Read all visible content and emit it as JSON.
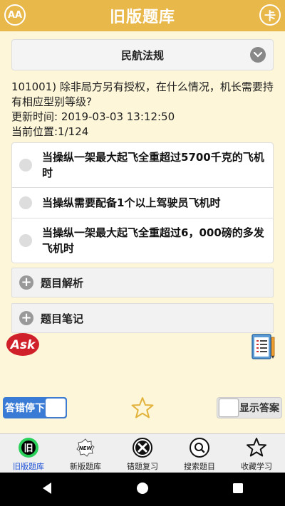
{
  "header": {
    "title": "旧版题库",
    "left_icon": "font-size-icon",
    "left_icon_text": "AA",
    "right_icon": "card-icon",
    "right_icon_text": "卡"
  },
  "category": {
    "selected": "民航法规"
  },
  "question": {
    "text": "101001) 除非局方另有授权，在什么情况，机长需要持有相应型别等级?",
    "updated": "更新时间: 2019-03-03 13:12:50",
    "position": "当前位置:1/124"
  },
  "options": [
    {
      "text": "当操纵一架最大起飞全重超过5700千克的飞机时"
    },
    {
      "text": "当操纵需要配备1个以上驾驶员飞机时"
    },
    {
      "text": "当操纵一架最大起飞全重超过6，000磅的多发飞机时"
    }
  ],
  "sections": {
    "analysis": "题目解析",
    "notes": "题目笔记"
  },
  "ask_logo_text": "Ask",
  "toggles": {
    "stop_on_wrong": "答错停下",
    "show_answer": "显示答案"
  },
  "bottom_nav": [
    {
      "label": "旧版题库",
      "icon": "old-bank-icon",
      "icon_text": "旧",
      "active": true
    },
    {
      "label": "新版题库",
      "icon": "new-badge-icon",
      "icon_text": "NEW",
      "active": false
    },
    {
      "label": "错题复习",
      "icon": "wrong-review-icon",
      "icon_text": "",
      "active": false
    },
    {
      "label": "搜索题目",
      "icon": "search-icon",
      "icon_text": "",
      "active": false
    },
    {
      "label": "收藏学习",
      "icon": "favorites-star-icon",
      "icon_text": "",
      "active": false
    }
  ],
  "colors": {
    "header": "#e8b84a",
    "background": "#fdf6d8",
    "active_nav": "#1a4fd6",
    "toggle_on": "#3a7bd5"
  }
}
